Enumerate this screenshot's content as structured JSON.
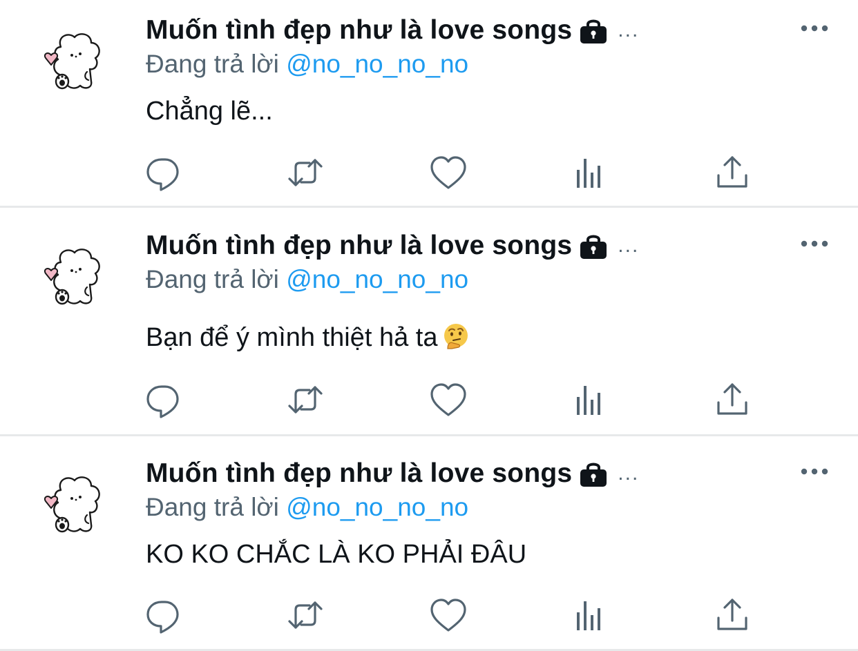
{
  "colors": {
    "name": "#0f1419",
    "secondary": "#536471",
    "link": "#1d9bf0",
    "divider": "#e7e9ea",
    "avatar_heart": "#f2b8c6"
  },
  "icons": [
    "avatar-puppy-icon",
    "lock-icon",
    "more-icon",
    "reply-icon",
    "retweet-icon",
    "like-icon",
    "analytics-icon",
    "share-icon",
    "thinking-face-emoji"
  ],
  "tweets": [
    {
      "display_name": "Muốn tình đẹp như là love songs",
      "name_ellipsis": "...",
      "reply_prefix": "Đang trả lời",
      "reply_handle": "@no_no_no_no",
      "text": "Chẳng lẽ..."
    },
    {
      "display_name": "Muốn tình đẹp như là love songs",
      "name_ellipsis": "...",
      "reply_prefix": "Đang trả lời",
      "reply_handle": "@no_no_no_no",
      "text": "Bạn để ý mình thiệt hả ta"
    },
    {
      "display_name": "Muốn tình đẹp như là love songs",
      "name_ellipsis": "...",
      "reply_prefix": "Đang trả lời",
      "reply_handle": "@no_no_no_no",
      "text": "KO KO CHẮC LÀ KO PHẢI ĐÂU"
    }
  ]
}
